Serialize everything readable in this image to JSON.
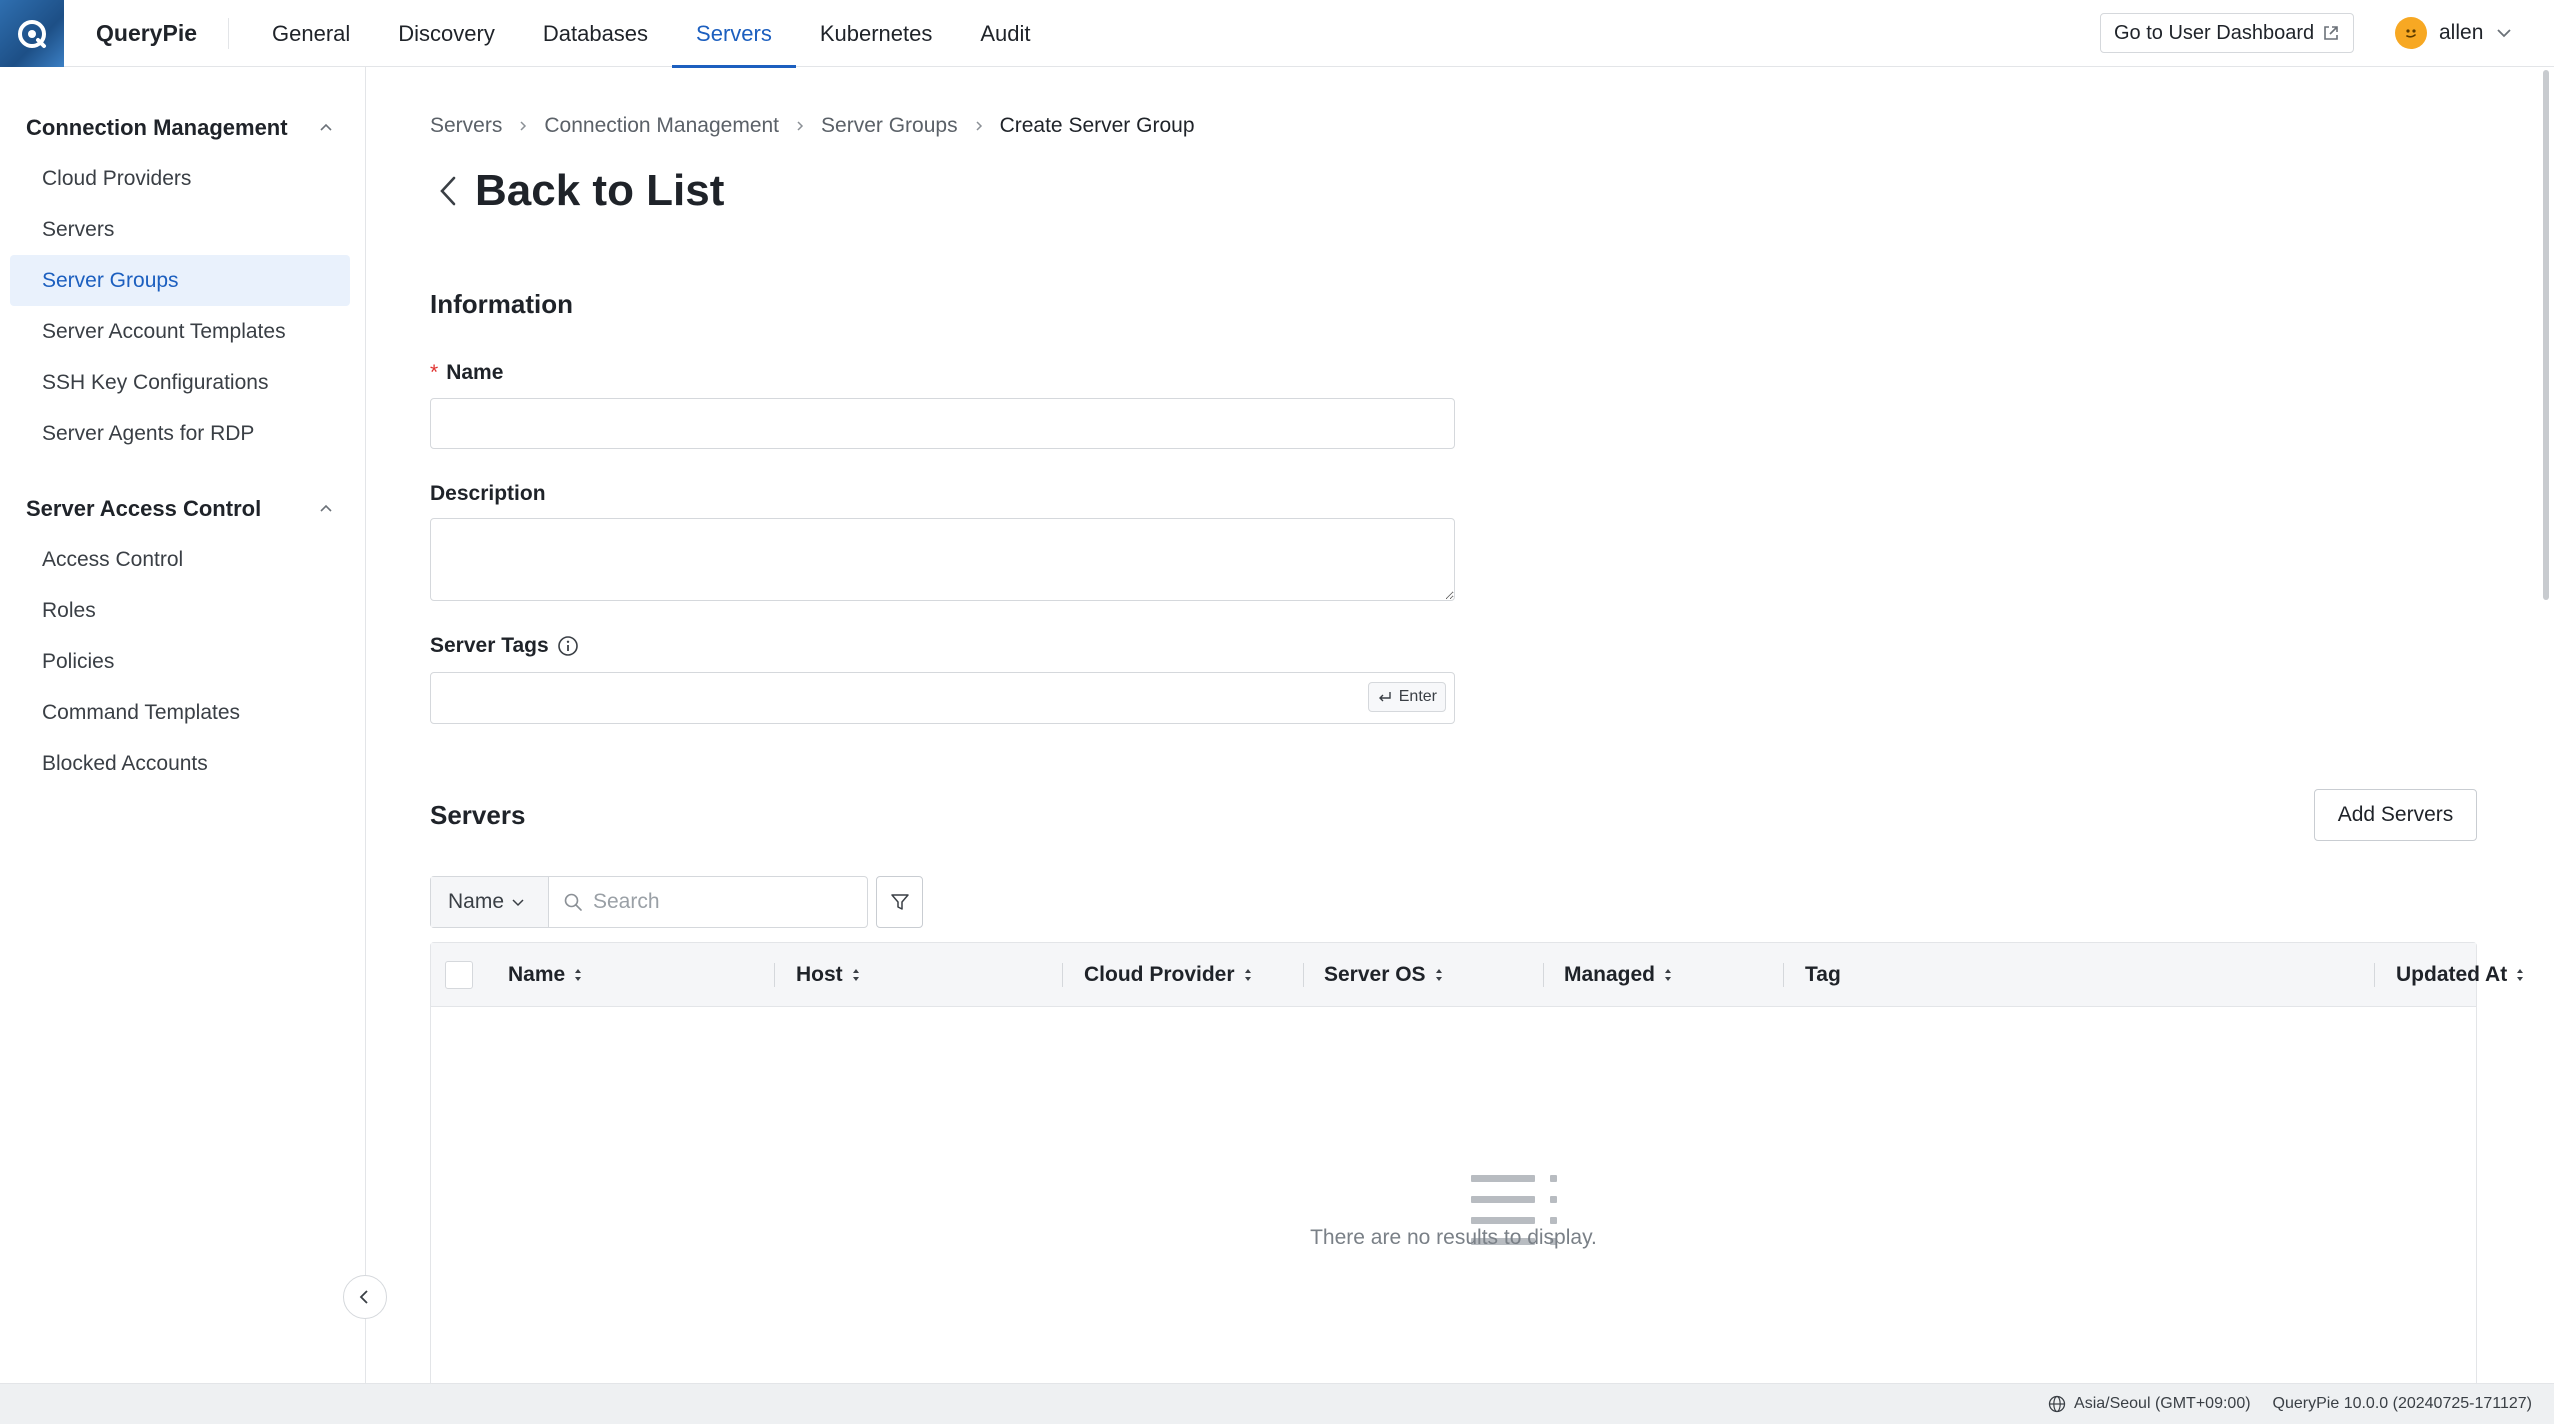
{
  "app": {
    "brand": "QueryPie",
    "nav": [
      {
        "label": "General",
        "active": false
      },
      {
        "label": "Discovery",
        "active": false
      },
      {
        "label": "Databases",
        "active": false
      },
      {
        "label": "Servers",
        "active": true
      },
      {
        "label": "Kubernetes",
        "active": false
      },
      {
        "label": "Audit",
        "active": false
      }
    ],
    "dashboard_button": "Go to User Dashboard",
    "user_name": "allen",
    "accent_color": "#1c5fbf"
  },
  "sidebar": {
    "sections": [
      {
        "title": "Connection Management",
        "items": [
          {
            "label": "Cloud Providers",
            "active": false
          },
          {
            "label": "Servers",
            "active": false
          },
          {
            "label": "Server Groups",
            "active": true
          },
          {
            "label": "Server Account Templates",
            "active": false
          },
          {
            "label": "SSH Key Configurations",
            "active": false
          },
          {
            "label": "Server Agents for RDP",
            "active": false
          }
        ]
      },
      {
        "title": "Server Access Control",
        "items": [
          {
            "label": "Access Control",
            "active": false
          },
          {
            "label": "Roles",
            "active": false
          },
          {
            "label": "Policies",
            "active": false
          },
          {
            "label": "Command Templates",
            "active": false
          },
          {
            "label": "Blocked Accounts",
            "active": false
          }
        ]
      }
    ]
  },
  "breadcrumb": [
    "Servers",
    "Connection Management",
    "Server Groups",
    "Create Server Group"
  ],
  "page": {
    "back_label": "Back to List",
    "information_title": "Information",
    "name_label": "Name",
    "name_value": "",
    "description_label": "Description",
    "description_value": "",
    "server_tags_label": "Server Tags",
    "enter_hint": "Enter",
    "servers_title": "Servers",
    "add_servers_button": "Add Servers"
  },
  "search": {
    "field_select": "Name",
    "placeholder": "Search"
  },
  "table": {
    "columns": [
      "Name",
      "Host",
      "Cloud Provider",
      "Server OS",
      "Managed",
      "Tag",
      "Updated At"
    ],
    "rows": [],
    "empty_text": "There are no results to display."
  },
  "footer": {
    "timezone": "Asia/Seoul (GMT+09:00)",
    "version": "QueryPie 10.0.0 (20240725-171127)"
  }
}
